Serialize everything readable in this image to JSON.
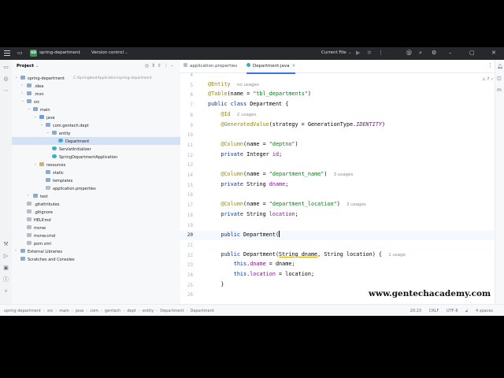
{
  "titlebar": {
    "project_badge": "SD",
    "project_name": "spring-department",
    "vcs": "Version control",
    "run_config": "Current File"
  },
  "project_panel": {
    "title": "Project",
    "tree": [
      {
        "label": "spring-department",
        "path": "C:\\SpringbootApplication\\spring-department",
        "depth": 0,
        "arrow": "v",
        "icon": "folder"
      },
      {
        "label": ".idea",
        "depth": 1,
        "arrow": ">",
        "icon": "folder"
      },
      {
        "label": ".mvn",
        "depth": 1,
        "arrow": ">",
        "icon": "folder"
      },
      {
        "label": "src",
        "depth": 1,
        "arrow": "v",
        "icon": "folder"
      },
      {
        "label": "main",
        "depth": 2,
        "arrow": "v",
        "icon": "folder"
      },
      {
        "label": "java",
        "depth": 3,
        "arrow": "v",
        "icon": "folder-blue"
      },
      {
        "label": "com.gentech.dept",
        "depth": 4,
        "arrow": "v",
        "icon": "folder"
      },
      {
        "label": "entity",
        "depth": 5,
        "arrow": "v",
        "icon": "folder"
      },
      {
        "label": "Department",
        "depth": 6,
        "arrow": "",
        "icon": "class",
        "selected": true
      },
      {
        "label": "ServletInitializer",
        "depth": 5,
        "arrow": "",
        "icon": "class"
      },
      {
        "label": "SpringDepartmentApplication",
        "depth": 5,
        "arrow": "",
        "icon": "class"
      },
      {
        "label": "resources",
        "depth": 3,
        "arrow": "v",
        "icon": "folder-yellow"
      },
      {
        "label": "static",
        "depth": 4,
        "arrow": "",
        "icon": "folder"
      },
      {
        "label": "templates",
        "depth": 4,
        "arrow": "",
        "icon": "folder"
      },
      {
        "label": "application.properties",
        "depth": 4,
        "arrow": "",
        "icon": "file"
      },
      {
        "label": "test",
        "depth": 2,
        "arrow": ">",
        "icon": "folder"
      },
      {
        "label": ".gitattributes",
        "depth": 1,
        "arrow": "",
        "icon": "file"
      },
      {
        "label": ".gitignore",
        "depth": 1,
        "arrow": "",
        "icon": "file"
      },
      {
        "label": "HELP.md",
        "depth": 1,
        "arrow": "",
        "icon": "file"
      },
      {
        "label": "mvnw",
        "depth": 1,
        "arrow": "",
        "icon": "file"
      },
      {
        "label": "mvnw.cmd",
        "depth": 1,
        "arrow": "",
        "icon": "file"
      },
      {
        "label": "pom.xml",
        "depth": 1,
        "arrow": "",
        "icon": "file"
      },
      {
        "label": "External Libraries",
        "depth": 0,
        "arrow": ">",
        "icon": "folder"
      },
      {
        "label": "Scratches and Consoles",
        "depth": 0,
        "arrow": "",
        "icon": "folder"
      }
    ]
  },
  "editor": {
    "tabs": [
      {
        "label": "application.properties",
        "active": false
      },
      {
        "label": "Department.java",
        "active": true
      }
    ],
    "inspections": "⚠ 7  ✓ 6",
    "current_line": "20",
    "lines": [
      {
        "n": "4",
        "html": ""
      },
      {
        "n": "5",
        "html": "<span class='ann'>@Entity</span>  <span class='hint'>no usages</span>"
      },
      {
        "n": "6",
        "html": "<span class='ann'>@Table</span>(name = <span class='str'>\"tbl_departments\"</span>)"
      },
      {
        "n": "7",
        "html": "<span class='kw'>public class</span> Department {"
      },
      {
        "n": "8",
        "html": "    <span class='ann'>@Id</span>  <span class='hint'>2 usages</span>"
      },
      {
        "n": "9",
        "html": "    <span class='ann'>@GeneratedValue</span>(strategy = GenerationType.<span class='cst'>IDENTITY</span>)"
      },
      {
        "n": "10",
        "html": ""
      },
      {
        "n": "11",
        "html": "    <span class='ann'>@Column</span>(name = <span class='str'>\"deptno\"</span>)"
      },
      {
        "n": "12",
        "html": "    <span class='kw'>private</span> Integer <span class='fld'>id</span>;"
      },
      {
        "n": "13",
        "html": ""
      },
      {
        "n": "14",
        "html": "    <span class='ann'>@Column</span>(name = <span class='str'>\"department_name\"</span>)  <span class='hint'>3 usages</span>"
      },
      {
        "n": "15",
        "html": "    <span class='kw'>private</span> String <span class='fld'>dname</span>;"
      },
      {
        "n": "16",
        "html": ""
      },
      {
        "n": "17",
        "html": "    <span class='ann'>@Column</span>(name = <span class='str'>\"department_location\"</span>)  <span class='hint'>3 usages</span>"
      },
      {
        "n": "18",
        "html": "    <span class='kw'>private</span> String <span class='fld'>location</span>;"
      },
      {
        "n": "19",
        "html": ""
      },
      {
        "n": "20",
        "html": "    <span class='kw'>public</span> Department(<span class='caret'></span>"
      },
      {
        "n": "21",
        "html": ""
      },
      {
        "n": "22",
        "html": "    <span class='kw'>public</span> Department(<span class='squig'>String dname</span>, String location) {  <span class='hint'>1 usage</span>"
      },
      {
        "n": "23",
        "html": "        <span class='kw'>this</span>.<span class='fld'>dname</span> = dname;"
      },
      {
        "n": "24",
        "html": "        <span class='kw'>this</span>.<span class='fld'>location</span> = location;"
      },
      {
        "n": "25",
        "html": "    }"
      },
      {
        "n": "26",
        "html": ""
      }
    ]
  },
  "statusbar": {
    "breadcrumbs": [
      "spring-department",
      "src",
      "main",
      "java",
      "com",
      "gentech",
      "dept",
      "entity",
      "Department",
      "Department"
    ],
    "position": "20:23",
    "line_sep": "CRLF",
    "encoding": "UTF-8",
    "indent": "4 spaces"
  },
  "watermark": "www.gentechacademy.com",
  "colors": {
    "titlebar_bg": "#27282c",
    "selection": "#d5e1f5",
    "keyword": "#0033b3",
    "annotation": "#9e880d",
    "string": "#067d17",
    "field": "#871094"
  }
}
